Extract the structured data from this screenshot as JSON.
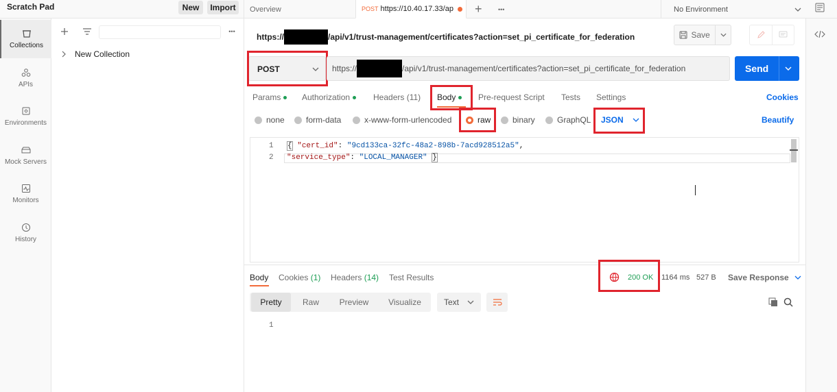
{
  "workspace": {
    "name": "Scratch Pad",
    "new_label": "New",
    "import_label": "Import"
  },
  "tabs": {
    "overview": "Overview",
    "active_method": "POST",
    "active_title": "https://10.40.17.33/ap",
    "add": "+",
    "more": "•••"
  },
  "environment": {
    "selected": "No Environment"
  },
  "sidebar": {
    "items": [
      {
        "label": "Collections",
        "icon": "collections-icon"
      },
      {
        "label": "APIs",
        "icon": "apis-icon"
      },
      {
        "label": "Environments",
        "icon": "environments-icon"
      },
      {
        "label": "Mock Servers",
        "icon": "mock-servers-icon"
      },
      {
        "label": "Monitors",
        "icon": "monitors-icon"
      },
      {
        "label": "History",
        "icon": "history-icon"
      }
    ]
  },
  "panel": {
    "collection": "New Collection",
    "more": "•••"
  },
  "request": {
    "url_prefix": "https://",
    "url_suffix": "/api/v1/trust-management/certificates?action=set_pi_certificate_for_federation",
    "save_label": "Save",
    "method": "POST",
    "send_label": "Send"
  },
  "request_tabs": {
    "params": "Params",
    "authorization": "Authorization",
    "headers": "Headers (11)",
    "body": "Body",
    "pre_request": "Pre-request Script",
    "tests": "Tests",
    "settings": "Settings",
    "cookies": "Cookies"
  },
  "body_types": {
    "none": "none",
    "form_data": "form-data",
    "urlencoded": "x-www-form-urlencoded",
    "raw": "raw",
    "binary": "binary",
    "graphql": "GraphQL",
    "format": "JSON",
    "beautify": "Beautify"
  },
  "editor": {
    "line_numbers": [
      "1",
      "2"
    ],
    "line1_open": "{",
    "line1_key": "\"cert_id\"",
    "line1_colon": ": ",
    "line1_value": "\"9cd133ca-32fc-48a2-898b-7acd928512a5\"",
    "line1_comma": ",",
    "line2_key": "\"service_type\"",
    "line2_colon": ": ",
    "line2_value": "\"LOCAL_MANAGER\"",
    "line2_close": "}"
  },
  "response": {
    "tabs": {
      "body": "Body",
      "cookies": "Cookies",
      "cookies_count": "(1)",
      "headers": "Headers",
      "headers_count": "(14)",
      "test_results": "Test Results"
    },
    "status": "200 OK",
    "time": "1164 ms",
    "size": "527 B",
    "save_response": "Save Response",
    "views": [
      "Pretty",
      "Raw",
      "Preview",
      "Visualize"
    ],
    "format": "Text",
    "line_numbers": [
      "1"
    ]
  },
  "colors": {
    "accent": "#0b6bea",
    "highlight": "#e0242d",
    "success": "#1e9e55",
    "tab_dot": "#f26b3a"
  }
}
